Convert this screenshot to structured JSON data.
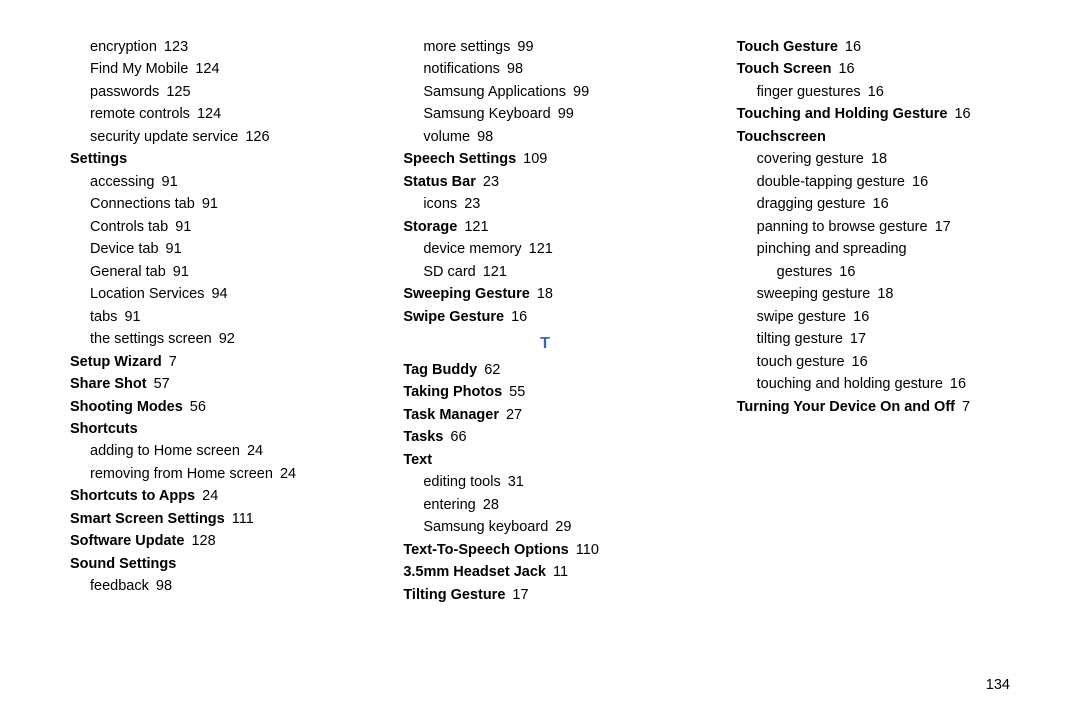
{
  "footer_page": "134",
  "columns": [
    [
      {
        "type": "sub",
        "label": "encryption",
        "page": "123"
      },
      {
        "type": "sub",
        "label": "Find My Mobile",
        "page": "124"
      },
      {
        "type": "sub",
        "label": "passwords",
        "page": "125"
      },
      {
        "type": "sub",
        "label": "remote controls",
        "page": "124"
      },
      {
        "type": "sub",
        "label": "security update service",
        "page": "126"
      },
      {
        "type": "heading",
        "label": "Settings",
        "page": ""
      },
      {
        "type": "sub",
        "label": "accessing",
        "page": "91"
      },
      {
        "type": "sub",
        "label": "Connections tab",
        "page": "91"
      },
      {
        "type": "sub",
        "label": "Controls tab",
        "page": "91"
      },
      {
        "type": "sub",
        "label": "Device tab",
        "page": "91"
      },
      {
        "type": "sub",
        "label": "General tab",
        "page": "91"
      },
      {
        "type": "sub",
        "label": "Location Services",
        "page": "94"
      },
      {
        "type": "sub",
        "label": "tabs",
        "page": "91"
      },
      {
        "type": "sub",
        "label": "the settings screen",
        "page": "92"
      },
      {
        "type": "heading",
        "label": "Setup Wizard",
        "page": "7"
      },
      {
        "type": "heading",
        "label": "Share Shot",
        "page": "57"
      },
      {
        "type": "heading",
        "label": "Shooting Modes",
        "page": "56"
      },
      {
        "type": "heading",
        "label": "Shortcuts",
        "page": ""
      },
      {
        "type": "sub",
        "label": "adding to Home screen",
        "page": "24"
      },
      {
        "type": "sub",
        "label": "removing from Home screen",
        "page": "24"
      },
      {
        "type": "heading",
        "label": "Shortcuts to Apps",
        "page": "24"
      },
      {
        "type": "heading",
        "label": "Smart Screen Settings",
        "page": "111"
      },
      {
        "type": "heading",
        "label": "Software Update",
        "page": "128"
      }
    ],
    [
      {
        "type": "heading",
        "label": "Sound Settings",
        "page": ""
      },
      {
        "type": "sub",
        "label": "feedback",
        "page": "98"
      },
      {
        "type": "sub",
        "label": "more settings",
        "page": "99"
      },
      {
        "type": "sub",
        "label": "notifications",
        "page": "98"
      },
      {
        "type": "sub",
        "label": "Samsung Applications",
        "page": "99"
      },
      {
        "type": "sub",
        "label": "Samsung Keyboard",
        "page": "99"
      },
      {
        "type": "sub",
        "label": "volume",
        "page": "98"
      },
      {
        "type": "heading",
        "label": "Speech Settings",
        "page": "109"
      },
      {
        "type": "heading",
        "label": "Status Bar",
        "page": "23"
      },
      {
        "type": "sub",
        "label": "icons",
        "page": "23"
      },
      {
        "type": "heading",
        "label": "Storage",
        "page": "121"
      },
      {
        "type": "sub",
        "label": "device memory",
        "page": "121"
      },
      {
        "type": "sub",
        "label": "SD card",
        "page": "121"
      },
      {
        "type": "heading",
        "label": "Sweeping Gesture",
        "page": "18"
      },
      {
        "type": "heading",
        "label": "Swipe Gesture",
        "page": "16"
      },
      {
        "type": "letter",
        "label": "T"
      },
      {
        "type": "heading",
        "label": "Tag Buddy",
        "page": "62"
      },
      {
        "type": "heading",
        "label": "Taking Photos",
        "page": "55"
      },
      {
        "type": "heading",
        "label": "Task Manager",
        "page": "27"
      },
      {
        "type": "heading",
        "label": "Tasks",
        "page": "66"
      },
      {
        "type": "heading",
        "label": "Text",
        "page": ""
      },
      {
        "type": "sub",
        "label": "editing tools",
        "page": "31"
      },
      {
        "type": "sub",
        "label": "entering",
        "page": "28"
      },
      {
        "type": "sub",
        "label": "Samsung keyboard",
        "page": "29"
      }
    ],
    [
      {
        "type": "heading",
        "label": "Text-To-Speech Options",
        "page": "110"
      },
      {
        "type": "heading",
        "label": "3.5mm Headset Jack",
        "page": "11"
      },
      {
        "type": "heading",
        "label": "Tilting Gesture",
        "page": "17"
      },
      {
        "type": "heading",
        "label": "Touch Gesture",
        "page": "16"
      },
      {
        "type": "heading",
        "label": "Touch Screen",
        "page": "16"
      },
      {
        "type": "sub",
        "label": "finger guestures",
        "page": "16"
      },
      {
        "type": "heading",
        "label": "Touching and Holding Gesture",
        "page": "16"
      },
      {
        "type": "heading",
        "label": "Touchscreen",
        "page": ""
      },
      {
        "type": "sub",
        "label": "covering gesture",
        "page": "18"
      },
      {
        "type": "sub",
        "label": "double-tapping gesture",
        "page": "16"
      },
      {
        "type": "sub",
        "label": "dragging gesture",
        "page": "16"
      },
      {
        "type": "sub",
        "label": "panning to browse gesture",
        "page": "17"
      },
      {
        "type": "sub",
        "label": "pinching and spreading",
        "page": ""
      },
      {
        "type": "sub2",
        "label": "gestures",
        "page": "16"
      },
      {
        "type": "sub",
        "label": "sweeping gesture",
        "page": "18"
      },
      {
        "type": "sub",
        "label": "swipe gesture",
        "page": "16"
      },
      {
        "type": "sub",
        "label": "tilting gesture",
        "page": "17"
      },
      {
        "type": "sub",
        "label": "touch gesture",
        "page": "16"
      },
      {
        "type": "sub",
        "label": "touching and holding gesture",
        "page": "16"
      },
      {
        "type": "heading",
        "label": "Turning Your Device On and Off",
        "page": "7"
      }
    ]
  ]
}
